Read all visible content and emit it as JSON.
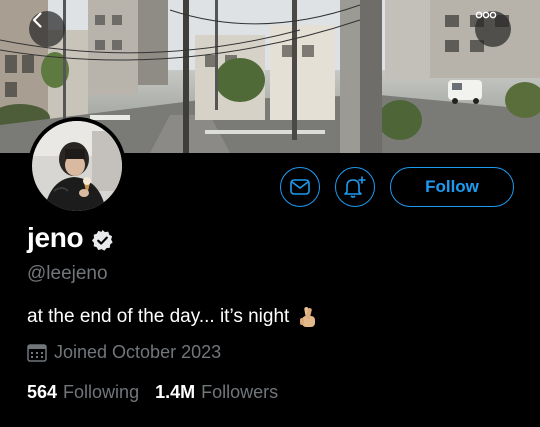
{
  "profile": {
    "display_name": "jeno",
    "handle": "@leejeno",
    "bio": "at the end of the day... it’s night",
    "joined": "Joined October 2023",
    "verified": true
  },
  "stats": {
    "following_count": "564",
    "following_label": "Following",
    "followers_count": "1.4M",
    "followers_label": "Followers"
  },
  "actions": {
    "follow_label": "Follow"
  },
  "icons": {
    "back": "back-chevron-icon",
    "more": "more-dots-icon",
    "message": "mail-icon",
    "notify": "bell-plus-icon",
    "verified": "verified-badge-icon",
    "calendar": "calendar-icon",
    "bio_emoji": "crossed-fingers-emoji"
  },
  "colors": {
    "accent": "#1d9bf0",
    "background": "#000000",
    "secondary_text": "#71767b"
  }
}
